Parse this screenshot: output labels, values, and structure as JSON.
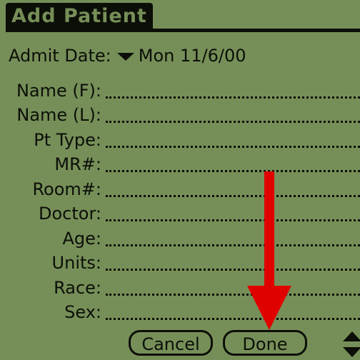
{
  "window": {
    "title": "Add Patient"
  },
  "admit": {
    "label": "Admit Date:",
    "value": "Mon 11/6/00"
  },
  "fields": [
    {
      "label": "Name (F):",
      "value": ""
    },
    {
      "label": "Name (L):",
      "value": ""
    },
    {
      "label": "Pt Type:",
      "value": ""
    },
    {
      "label": "MR#:",
      "value": ""
    },
    {
      "label": "Room#:",
      "value": ""
    },
    {
      "label": "Doctor:",
      "value": ""
    },
    {
      "label": "Age:",
      "value": ""
    },
    {
      "label": "Units:",
      "value": ""
    },
    {
      "label": "Race:",
      "value": ""
    },
    {
      "label": "Sex:",
      "value": ""
    }
  ],
  "buttons": {
    "cancel": "Cancel",
    "done": "Done"
  },
  "icons": {
    "dropdown": "triangle-down-icon",
    "scroll": "scroll-arrows-icon"
  },
  "colors": {
    "screen": "#768f58",
    "ink": "#0c0f08",
    "annotation": "#e00000"
  }
}
